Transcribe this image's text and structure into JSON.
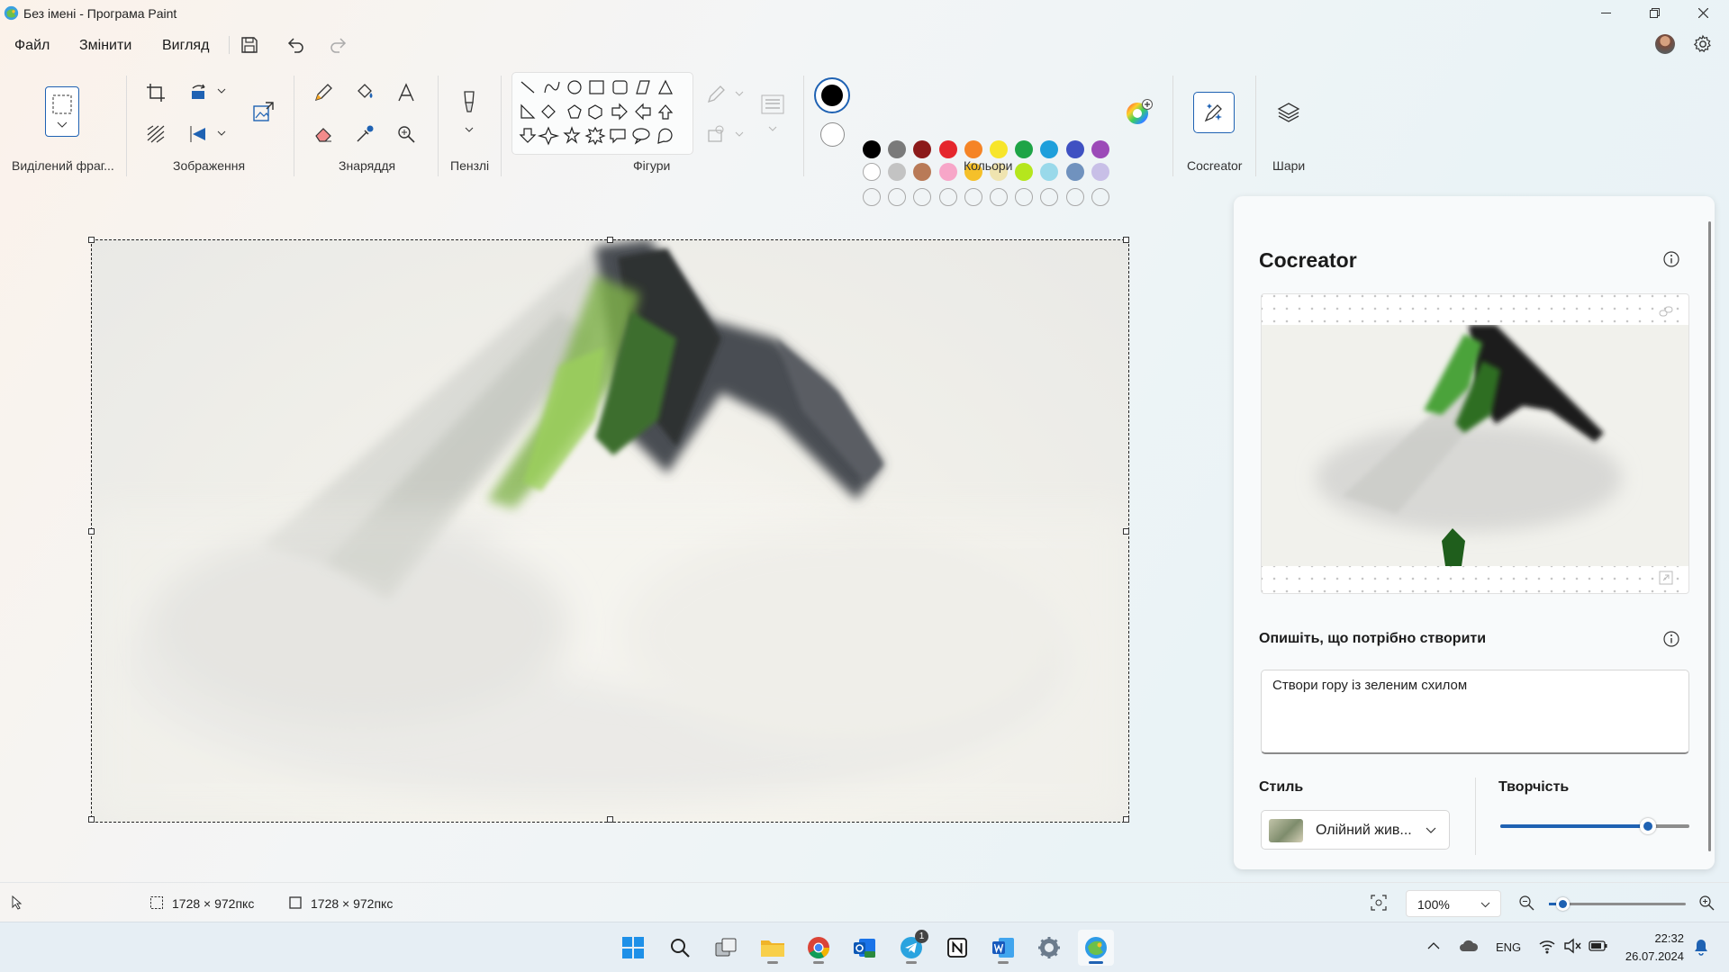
{
  "window": {
    "title": "Без імені - Програма Paint"
  },
  "menu": {
    "file": "Файл",
    "edit": "Змінити",
    "view": "Вигляд"
  },
  "ribbon": {
    "groups": {
      "selection": "Виділений фраг...",
      "image": "Зображення",
      "tools": "Знаряддя",
      "brushes": "Пензлі",
      "shapes": "Фігури",
      "colors": "Кольори",
      "cocreator": "Cocreator",
      "layers": "Шари"
    },
    "colors": {
      "color1": "#000000",
      "color2": "#ffffff",
      "palette_row1": [
        "#000000",
        "#7a7a7a",
        "#8c1a1a",
        "#e5262d",
        "#f58426",
        "#f7e52a",
        "#1ea446",
        "#1e9fdb",
        "#3f51c2",
        "#9c4ab8"
      ],
      "palette_row2": [
        "#ffffff",
        "#c3c3c3",
        "#b97a57",
        "#f7a6c8",
        "#f5c02a",
        "#efe4b0",
        "#b5e61d",
        "#99d9ea",
        "#7092be",
        "#c8bfe7"
      ],
      "palette_row3_count": 10
    }
  },
  "cocreator": {
    "title": "Cocreator",
    "prompt_label": "Опишіть, що потрібно створити",
    "prompt_value": "Створи гору із зеленим схилом",
    "style_label": "Стиль",
    "style_value": "Олійний жив...",
    "creativity_label": "Творчість",
    "creativity_level": 0.78
  },
  "status": {
    "selection_size": "1728 × 972пкс",
    "canvas_size": "1728 × 972пкс",
    "zoom": "100%",
    "zoom_slider_level": 0.1
  },
  "taskbar": {
    "apps": [
      "start-icon",
      "search-icon",
      "task-view-icon",
      "file-explorer-icon",
      "chrome-icon",
      "outlook-icon",
      "telegram-icon",
      "notion-icon",
      "word-icon",
      "settings-icon",
      "paint-icon"
    ],
    "telegram_badge": "1",
    "language": "ENG",
    "time": "22:32",
    "date": "26.07.2024"
  }
}
